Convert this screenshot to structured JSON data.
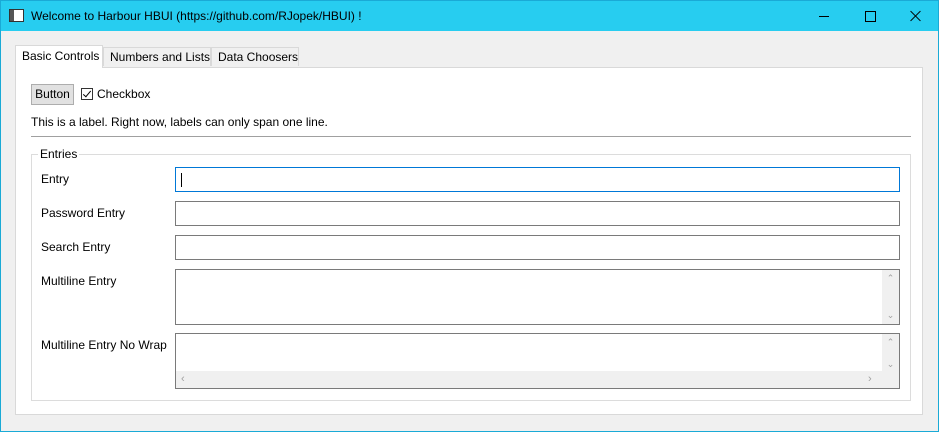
{
  "window": {
    "title": "Welcome to Harbour HBUI (https://github.com/RJopek/HBUI) !",
    "accent_color": "#27cdf0"
  },
  "tabs": [
    {
      "label": "Basic Controls",
      "active": true
    },
    {
      "label": "Numbers and Lists",
      "active": false
    },
    {
      "label": "Data Choosers",
      "active": false
    }
  ],
  "basic": {
    "button_label": "Button",
    "checkbox_label": "Checkbox",
    "checkbox_checked": true,
    "label_text": "This is a label. Right now, labels can only span one line."
  },
  "entries": {
    "group_title": "Entries",
    "fields": [
      {
        "label": "Entry",
        "value": ""
      },
      {
        "label": "Password Entry",
        "value": ""
      },
      {
        "label": "Search Entry",
        "value": ""
      },
      {
        "label": "Multiline Entry",
        "value": ""
      },
      {
        "label": "Multiline Entry No Wrap",
        "value": ""
      }
    ]
  },
  "icons": {
    "scroll_up": "chevron-up-icon",
    "scroll_down": "chevron-down-icon",
    "scroll_left": "chevron-left-icon",
    "scroll_right": "chevron-right-icon"
  }
}
